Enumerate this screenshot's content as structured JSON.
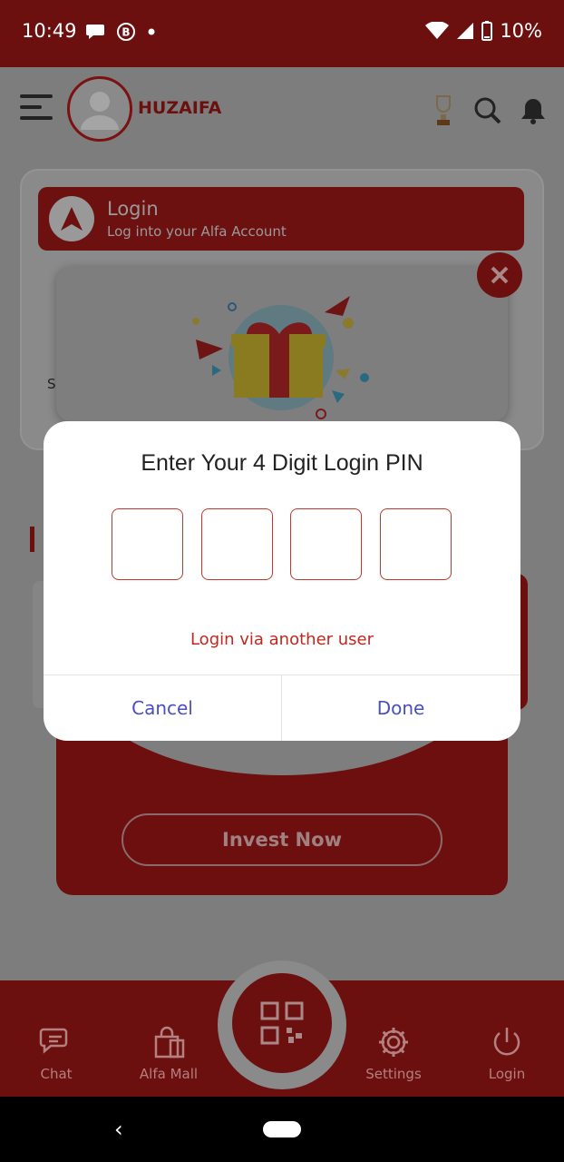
{
  "status_bar": {
    "time": "10:49",
    "battery": "10%"
  },
  "header": {
    "username": "HUZAIFA"
  },
  "login_strip": {
    "title": "Login",
    "subtitle": "Log into your Alfa Account"
  },
  "background_card": {
    "partial_text": "S"
  },
  "invest": {
    "button_label": "Invest Now"
  },
  "dialog": {
    "title": "Enter Your 4 Digit Login PIN",
    "pins": [
      "",
      "",
      "",
      ""
    ],
    "another_user_label": "Login via another user",
    "cancel_label": "Cancel",
    "done_label": "Done"
  },
  "bottom_nav": {
    "items": [
      {
        "label": "Chat",
        "icon": "chat-icon"
      },
      {
        "label": "Alfa Mall",
        "icon": "shopping-bag-icon"
      },
      {
        "label": "Settings",
        "icon": "gear-icon"
      },
      {
        "label": "Login",
        "icon": "power-icon"
      }
    ],
    "center_icon": "qr-code-icon"
  },
  "colors": {
    "brand_red": "#c0281e",
    "dialog_button": "#4a4fc0"
  }
}
